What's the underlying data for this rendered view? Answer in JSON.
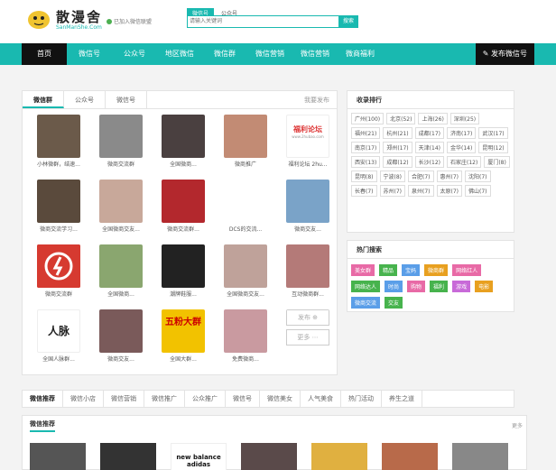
{
  "header": {
    "brand": "散漫舍",
    "brand_sub": "SanManShe.Com",
    "verified_text": "已加入微信联盟",
    "search_tabs": [
      "微信号",
      "公众号"
    ],
    "search_placeholder": "请输入关键词",
    "search_button": "搜索"
  },
  "nav": {
    "items": [
      "首页",
      "微信号",
      "公众号",
      "地区微信",
      "微信群",
      "微信营销",
      "微信营销",
      "微商福利"
    ],
    "publish": "发布微信号"
  },
  "left_panel": {
    "tabs": [
      "微信群",
      "公众号",
      "微信号"
    ],
    "more": "我要发布",
    "items": [
      {
        "caption": "小林微群，结速...",
        "color": "#6b5a4a"
      },
      {
        "caption": "微商交流群",
        "color": "#8a8a8a"
      },
      {
        "caption": "全国微商...",
        "color": "#4a4040"
      },
      {
        "caption": "微商推广",
        "color": "#c28b74"
      },
      {
        "caption": "福利论坛 2hu...",
        "color": "#ffffff"
      },
      {
        "caption": "微商交流学习...",
        "color": "#5a4a3c"
      },
      {
        "caption": "全国微商交友...",
        "color": "#c8a89a"
      },
      {
        "caption": "微商交流群...",
        "color": "#b3282d"
      },
      {
        "caption": "DCS的交流...",
        "color": "#ffffff"
      },
      {
        "caption": "微商交友...",
        "color": "#7aa3c8"
      },
      {
        "caption": "微商交流群",
        "color": "#d63a30"
      },
      {
        "caption": "全国微商...",
        "color": "#8aa66f"
      },
      {
        "caption": "潮牌鞋服...",
        "color": "#222222"
      },
      {
        "caption": "全国微商交友...",
        "color": "#bfa29a"
      },
      {
        "caption": "互动微商群...",
        "color": "#b47a78"
      },
      {
        "caption": "全国人脉群...",
        "color": "#b83a2e"
      },
      {
        "caption": "微商交友...",
        "color": "#7a5a5a"
      },
      {
        "caption": "全国大群...",
        "color": "#d45a30"
      },
      {
        "caption": "免费微商...",
        "color": "#c99aa0"
      },
      {
        "caption": "",
        "color": "#ffffff"
      }
    ],
    "publish_label": "发布",
    "more_label": "更多",
    "forum_title": "福利论坛",
    "forum_url": "www.2hubao.com",
    "people_label": "人脉",
    "big_group": "五粉大群"
  },
  "rank": {
    "title": "收录排行",
    "tags": [
      "广州(100)",
      "北京(52)",
      "上海(26)",
      "深圳(25)",
      "福州(21)",
      "杭州(21)",
      "成都(17)",
      "济南(17)",
      "武汉(17)",
      "南京(17)",
      "郑州(17)",
      "天津(14)",
      "金华(14)",
      "昆明(12)",
      "西安(13)",
      "成都(12)",
      "长沙(12)",
      "石家庄(12)",
      "厦门(8)",
      "昆明(8)",
      "宁波(8)",
      "合肥(7)",
      "惠州(7)",
      "沈阳(7)",
      "长春(7)",
      "苏州(7)",
      "泉州(7)",
      "太原(7)",
      "佛山(7)"
    ]
  },
  "hot": {
    "title": "热门搜索",
    "tags": [
      {
        "label": "美女群",
        "color": "#e86aa6"
      },
      {
        "label": "精品",
        "color": "#47b34d"
      },
      {
        "label": "宝妈",
        "color": "#5a9ee8"
      },
      {
        "label": "微商群",
        "color": "#e8a020"
      },
      {
        "label": "网络红人",
        "color": "#e86aa6"
      },
      {
        "label": "网络达人",
        "color": "#47b34d"
      },
      {
        "label": "时尚",
        "color": "#5a9ee8"
      },
      {
        "label": "购物",
        "color": "#e86aa6"
      },
      {
        "label": "福利",
        "color": "#47b34d"
      },
      {
        "label": "游戏",
        "color": "#c86ad8"
      },
      {
        "label": "电影",
        "color": "#e8a020"
      },
      {
        "label": "微商交流",
        "color": "#5a9ee8"
      },
      {
        "label": "交友",
        "color": "#47b34d"
      }
    ]
  },
  "bottom_tabs": [
    "微信推荐",
    "微信小店",
    "微信营销",
    "微信推广",
    "公众推广",
    "微信号",
    "微信美女",
    "人气美食",
    "热门活动",
    "养生之道"
  ],
  "rec": {
    "title": "微信推荐",
    "more": "更多",
    "thumb_colors": [
      "#555555",
      "#333333",
      "#d84a3a",
      "#5a4a4a",
      "#e0b040",
      "#b86a4a",
      "#888888"
    ],
    "ad_text": "new balance adidas"
  }
}
